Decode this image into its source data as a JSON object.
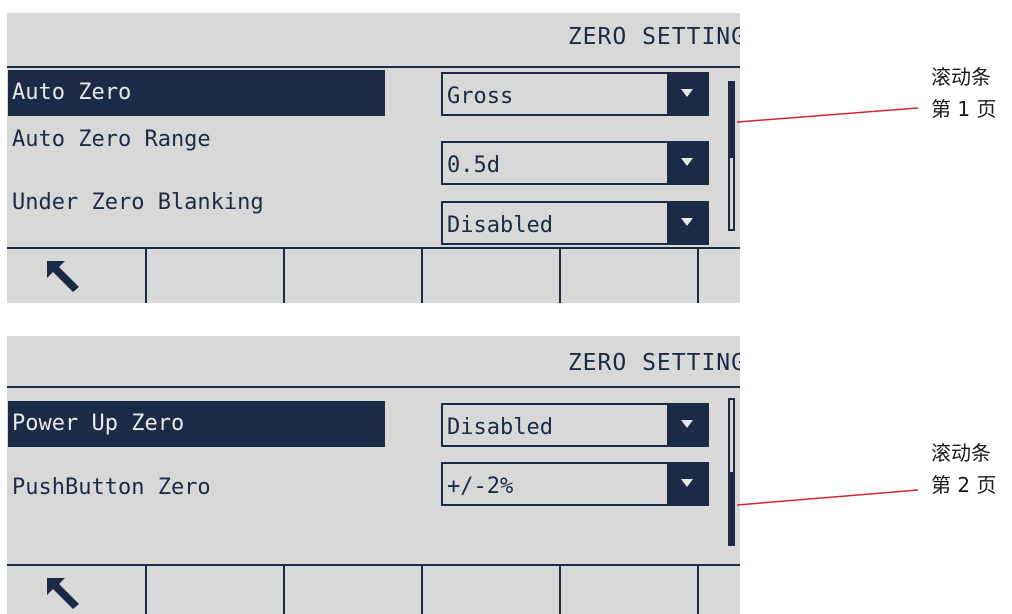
{
  "colors": {
    "accent": "#1b2b46",
    "background": "#d8d8d8",
    "leader_line": "#d0282c"
  },
  "screens": [
    {
      "title": "ZERO SETTING",
      "rows": [
        {
          "label": "Auto Zero",
          "value": "Gross",
          "selected": true
        },
        {
          "label": "Auto Zero Range",
          "value": "0.5d",
          "selected": false
        },
        {
          "label": "Under Zero Blanking",
          "value": "Disabled",
          "selected": false
        }
      ],
      "softkey_icon": "back-arrow-icon",
      "annotation": {
        "line1": "滚动条",
        "line2": "第 1 页"
      }
    },
    {
      "title": "ZERO SETTING",
      "rows": [
        {
          "label": "Power Up Zero",
          "value": "Disabled",
          "selected": true
        },
        {
          "label": "PushButton Zero",
          "value": "+/-2%",
          "selected": false
        }
      ],
      "softkey_icon": "back-arrow-icon",
      "annotation": {
        "line1": "滚动条",
        "line2": "第 2 页"
      }
    }
  ]
}
